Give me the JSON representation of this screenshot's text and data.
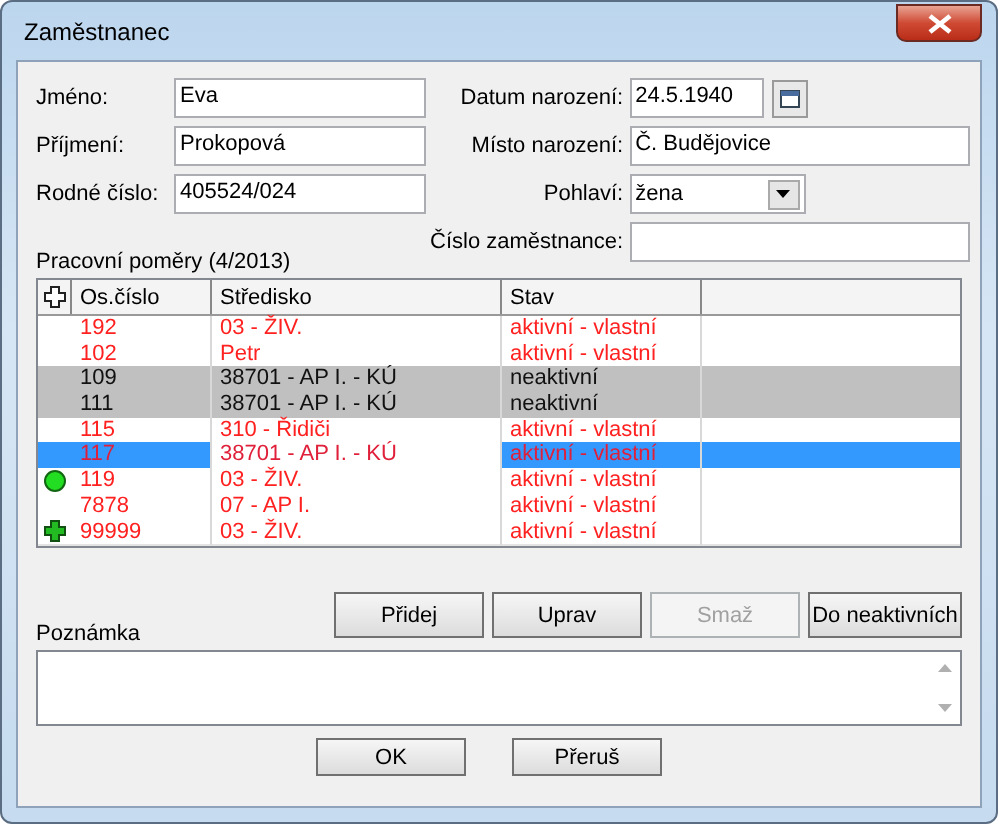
{
  "window": {
    "title": "Zaměstnanec"
  },
  "fields": {
    "jmeno": {
      "label": "Jméno:",
      "value": "Eva"
    },
    "prijmeni": {
      "label": "Příjmení:",
      "value": "Prokopová"
    },
    "rodne_cislo": {
      "label": "Rodné číslo:",
      "value": "405524/024"
    },
    "datum": {
      "label": "Datum narození:",
      "value": "24.5.1940"
    },
    "misto": {
      "label": "Místo narození:",
      "value": "Č. Budějovice"
    },
    "pohlavi": {
      "label": "Pohlaví:",
      "value": "žena"
    },
    "cislo_zamestnance": {
      "label": "Číslo zaměstnance:"
    }
  },
  "table": {
    "title": "Pracovní poměry (4/2013)",
    "columns": [
      "Os.číslo",
      "Středisko",
      "Stav"
    ],
    "rows": [
      {
        "kind": "plain",
        "active": true,
        "selected": false,
        "cells": [
          "192",
          "03 - ŽIV.",
          "aktivní - vlastní"
        ]
      },
      {
        "kind": "plain",
        "active": true,
        "selected": false,
        "cells": [
          "102",
          "Petr",
          "aktivní - vlastní"
        ]
      },
      {
        "kind": "plain",
        "active": false,
        "selected": false,
        "cells": [
          "109",
          "38701 - AP I. - KÚ",
          "neaktivní"
        ]
      },
      {
        "kind": "plain",
        "active": false,
        "selected": false,
        "cells": [
          "111",
          "38701 - AP I. - KÚ",
          "neaktivní"
        ]
      },
      {
        "kind": "plain",
        "active": true,
        "selected": false,
        "cells": [
          "115",
          "310 - Řidiči",
          "aktivní - vlastní"
        ]
      },
      {
        "kind": "plain",
        "active": true,
        "selected": true,
        "cells": [
          "117",
          "38701 - AP I. - KÚ",
          "aktivní - vlastní"
        ]
      },
      {
        "kind": "circle",
        "active": true,
        "selected": false,
        "cells": [
          "119",
          "03 - ŽIV.",
          "aktivní - vlastní"
        ]
      },
      {
        "kind": "plain",
        "active": true,
        "selected": false,
        "cells": [
          "7878",
          "07 - AP I.",
          "aktivní - vlastní"
        ]
      },
      {
        "kind": "plus",
        "active": true,
        "selected": false,
        "cells": [
          "99999",
          "03 - ŽIV.",
          "aktivní - vlastní"
        ]
      }
    ]
  },
  "row_buttons": [
    {
      "label": "Přidej",
      "disabled": false
    },
    {
      "label": "Uprav",
      "disabled": false
    },
    {
      "label": "Smaž",
      "disabled": true
    },
    {
      "label": "Do neaktivních",
      "disabled": false
    }
  ],
  "note": {
    "label": "Poznámka"
  },
  "buttons": [
    {
      "label": "OK"
    },
    {
      "label": "Přeruš"
    }
  ]
}
